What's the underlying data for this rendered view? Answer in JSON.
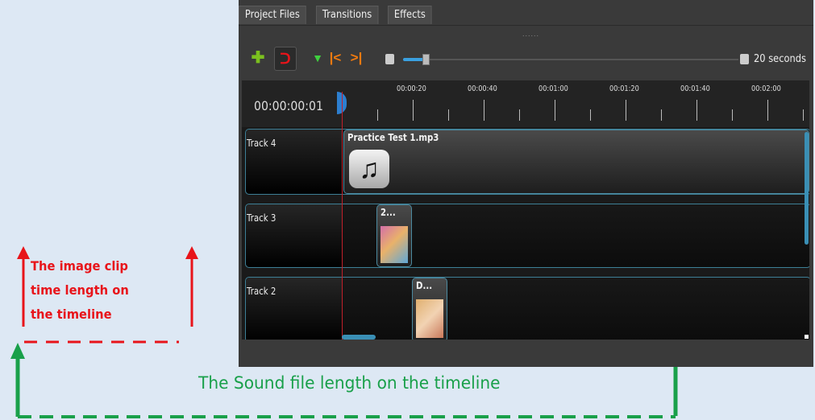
{
  "tabs": [
    {
      "label": "Project Files"
    },
    {
      "label": "Transitions"
    },
    {
      "label": "Effects"
    }
  ],
  "toolbar": {
    "grip": "......",
    "zoom_label": "20 seconds",
    "zoom_fraction": 0.05
  },
  "timeline": {
    "timecode": "00:00:00:01",
    "ruler_labels": [
      "00:00:20",
      "00:00:40",
      "00:01:00",
      "00:01:20",
      "00:01:40",
      "00:02:00"
    ],
    "tracks": [
      {
        "label": "Track 4"
      },
      {
        "label": "Track 3"
      },
      {
        "label": "Track 2"
      }
    ],
    "clips": [
      {
        "title": "Practice Test 1.mp3"
      },
      {
        "title": "2..."
      },
      {
        "title": "D..."
      }
    ]
  },
  "annotations": {
    "red_line1": "The image clip",
    "red_line2": "time length on",
    "red_line3": "the timeline",
    "green": "The Sound file length on the timeline"
  },
  "colors": {
    "annotation_red": "#e8141a",
    "annotation_green": "#19a04a",
    "accent": "#3aa0e0"
  }
}
